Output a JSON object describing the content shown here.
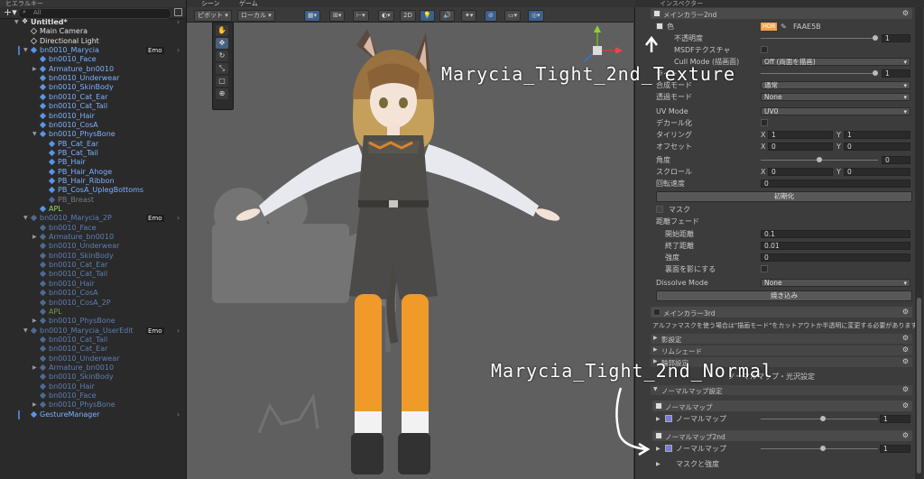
{
  "hierarchy": {
    "tab": "ヒエラルキー",
    "search": "All",
    "rows": [
      {
        "label": "Untitled*",
        "indent": 0,
        "icon": "unity-icon",
        "arrow": "▼",
        "style": "white",
        "emo": "",
        "chev": true
      },
      {
        "label": "Main Camera",
        "indent": 1,
        "icon": "cube-icon",
        "arrow": "",
        "style": "white",
        "emo": "",
        "chev": false
      },
      {
        "label": "Directional Light",
        "indent": 1,
        "icon": "cube-icon",
        "arrow": "",
        "style": "white",
        "emo": "",
        "chev": false
      },
      {
        "label": "bn0010_Marycia",
        "indent": 1,
        "icon": "prefab-icon",
        "arrow": "▼",
        "style": "blue",
        "emo": "Emo",
        "chev": true
      },
      {
        "label": "bn0010_Face",
        "indent": 2,
        "icon": "prefab-icon",
        "arrow": "",
        "style": "blue",
        "emo": "",
        "chev": false
      },
      {
        "label": "Armature_bn0010",
        "indent": 2,
        "icon": "prefab-icon",
        "arrow": "▶",
        "style": "blue",
        "emo": "",
        "chev": false
      },
      {
        "label": "bn0010_Underwear",
        "indent": 2,
        "icon": "prefab-icon",
        "arrow": "",
        "style": "blue",
        "emo": "",
        "chev": false
      },
      {
        "label": "bn0010_SkinBody",
        "indent": 2,
        "icon": "prefab-icon",
        "arrow": "",
        "style": "blue",
        "emo": "",
        "chev": false
      },
      {
        "label": "bn0010_Cat_Ear",
        "indent": 2,
        "icon": "prefab-icon",
        "arrow": "",
        "style": "blue",
        "emo": "",
        "chev": false
      },
      {
        "label": "bn0010_Cat_Tail",
        "indent": 2,
        "icon": "prefab-icon",
        "arrow": "",
        "style": "blue",
        "emo": "",
        "chev": false
      },
      {
        "label": "bn0010_Hair",
        "indent": 2,
        "icon": "prefab-icon",
        "arrow": "",
        "style": "blue",
        "emo": "",
        "chev": false
      },
      {
        "label": "bn0010_CosA",
        "indent": 2,
        "icon": "prefab-icon",
        "arrow": "",
        "style": "blue",
        "emo": "",
        "chev": false
      },
      {
        "label": "bn0010_PhysBone",
        "indent": 2,
        "icon": "prefab-icon",
        "arrow": "▼",
        "style": "blue",
        "emo": "",
        "chev": false
      },
      {
        "label": "PB_Cat_Ear",
        "indent": 3,
        "icon": "prefab-icon",
        "arrow": "",
        "style": "blue",
        "emo": "",
        "chev": false
      },
      {
        "label": "PB_Cat_Tail",
        "indent": 3,
        "icon": "prefab-icon",
        "arrow": "",
        "style": "blue",
        "emo": "",
        "chev": false
      },
      {
        "label": "PB_Hair",
        "indent": 3,
        "icon": "prefab-icon",
        "arrow": "",
        "style": "blue",
        "emo": "",
        "chev": false
      },
      {
        "label": "PB_Hair_Ahoge",
        "indent": 3,
        "icon": "prefab-icon",
        "arrow": "",
        "style": "blue",
        "emo": "",
        "chev": false
      },
      {
        "label": "PB_Hair_Ribbon",
        "indent": 3,
        "icon": "prefab-icon",
        "arrow": "",
        "style": "blue",
        "emo": "",
        "chev": false
      },
      {
        "label": "PB_CosA_UplegBottoms",
        "indent": 3,
        "icon": "prefab-icon",
        "arrow": "",
        "style": "blue",
        "emo": "",
        "chev": false
      },
      {
        "label": "PB_Breast",
        "indent": 3,
        "icon": "prefab-icon",
        "arrow": "",
        "style": "dimw",
        "emo": "",
        "chev": false
      },
      {
        "label": "APL",
        "indent": 2,
        "icon": "prefab-icon",
        "arrow": "",
        "style": "green",
        "emo": "",
        "chev": false
      },
      {
        "label": "bn0010_Marycia_2P",
        "indent": 1,
        "icon": "prefab-icon",
        "arrow": "▼",
        "style": "dim",
        "emo": "Emo",
        "chev": true
      },
      {
        "label": "bn0010_Face",
        "indent": 2,
        "icon": "prefab-icon",
        "arrow": "",
        "style": "dim",
        "emo": "",
        "chev": false
      },
      {
        "label": "Armature_bn0010",
        "indent": 2,
        "icon": "prefab-icon",
        "arrow": "▶",
        "style": "dim",
        "emo": "",
        "chev": false
      },
      {
        "label": "bn0010_Underwear",
        "indent": 2,
        "icon": "prefab-icon",
        "arrow": "",
        "style": "dim",
        "emo": "",
        "chev": false
      },
      {
        "label": "bn0010_SkinBody",
        "indent": 2,
        "icon": "prefab-icon",
        "arrow": "",
        "style": "dim",
        "emo": "",
        "chev": false
      },
      {
        "label": "bn0010_Cat_Ear",
        "indent": 2,
        "icon": "prefab-icon",
        "arrow": "",
        "style": "dim",
        "emo": "",
        "chev": false
      },
      {
        "label": "bn0010_Cat_Tail",
        "indent": 2,
        "icon": "prefab-icon",
        "arrow": "",
        "style": "dim",
        "emo": "",
        "chev": false
      },
      {
        "label": "bn0010_Hair",
        "indent": 2,
        "icon": "prefab-icon",
        "arrow": "",
        "style": "dim",
        "emo": "",
        "chev": false
      },
      {
        "label": "bn0010_CosA",
        "indent": 2,
        "icon": "prefab-icon",
        "arrow": "",
        "style": "dim",
        "emo": "",
        "chev": false
      },
      {
        "label": "bn0010_CosA_2P",
        "indent": 2,
        "icon": "prefab-icon",
        "arrow": "",
        "style": "dim",
        "emo": "",
        "chev": false
      },
      {
        "label": "APL",
        "indent": 2,
        "icon": "prefab-icon",
        "arrow": "",
        "style": "dimgreen",
        "emo": "",
        "chev": false
      },
      {
        "label": "bn0010_PhysBone",
        "indent": 2,
        "icon": "prefab-icon",
        "arrow": "▶",
        "style": "dim",
        "emo": "",
        "chev": false
      },
      {
        "label": "bn0010_Marycia_UserEdit",
        "indent": 1,
        "icon": "prefab-icon",
        "arrow": "▼",
        "style": "dim",
        "emo": "Emo",
        "chev": true
      },
      {
        "label": "bn0010_Cat_Tail",
        "indent": 2,
        "icon": "prefab-icon",
        "arrow": "",
        "style": "dim",
        "emo": "",
        "chev": false
      },
      {
        "label": "bn0010_Cat_Ear",
        "indent": 2,
        "icon": "prefab-icon",
        "arrow": "",
        "style": "dim",
        "emo": "",
        "chev": false
      },
      {
        "label": "bn0010_Underwear",
        "indent": 2,
        "icon": "prefab-icon",
        "arrow": "",
        "style": "dim",
        "emo": "",
        "chev": false
      },
      {
        "label": "Armature_bn0010",
        "indent": 2,
        "icon": "prefab-icon",
        "arrow": "▶",
        "style": "dim",
        "emo": "",
        "chev": false
      },
      {
        "label": "bn0010_SkinBody",
        "indent": 2,
        "icon": "prefab-icon",
        "arrow": "",
        "style": "dim",
        "emo": "",
        "chev": false
      },
      {
        "label": "bn0010_Hair",
        "indent": 2,
        "icon": "prefab-icon",
        "arrow": "",
        "style": "dim",
        "emo": "",
        "chev": false
      },
      {
        "label": "bn0010_Face",
        "indent": 2,
        "icon": "prefab-icon",
        "arrow": "",
        "style": "dim",
        "emo": "",
        "chev": false
      },
      {
        "label": "bn0010_PhysBone",
        "indent": 2,
        "icon": "prefab-icon",
        "arrow": "▶",
        "style": "dim",
        "emo": "",
        "chev": false
      },
      {
        "label": "GestureManager",
        "indent": 1,
        "icon": "prefab-icon",
        "arrow": "",
        "style": "blue",
        "emo": "",
        "chev": true
      }
    ]
  },
  "scene": {
    "tab_scene": "シーン",
    "tab_game": "ゲーム",
    "pivot": "ピボット",
    "local": "ローカル",
    "mode_2d": "2D",
    "annotation_texture": "Marycia_Tight_2nd_Texture",
    "annotation_normal": "Marycia_Tight_2nd_Normal"
  },
  "inspector": {
    "tab": "インスペクター",
    "main2": {
      "header": "メインカラー2nd",
      "color_label": "色",
      "hdr": "HDR",
      "hex": "FAAE5B",
      "opacity_label": "不透明度",
      "opacity_value": "1",
      "msdf_label": "MSDFテクスチャ",
      "cull_label": "Cull Mode (描画面)",
      "cull_value": "Off (両面を描画)",
      "light_label": "ライト",
      "light_value": "1",
      "blend_label": "合成モード",
      "blend_value": "通常",
      "alpha_label": "透過モード",
      "alpha_value": "None",
      "uv_label": "UV Mode",
      "uv_value": "UV0",
      "decal_label": "デカール化",
      "tiling_label": "タイリング",
      "tiling_x": "1",
      "tiling_y": "1",
      "offset_label": "オフセット",
      "offset_x": "0",
      "offset_y": "0",
      "angle_label": "角度",
      "angle_value": "0",
      "scroll_label": "スクロール",
      "scroll_x": "0",
      "scroll_y": "0",
      "rot_label": "回転速度",
      "rot_value": "0",
      "init_btn": "初期化",
      "mask_label": "マスク",
      "fade_label": "距離フェード",
      "fade_start_label": "開始距離",
      "fade_start_value": "0.1",
      "fade_end_label": "終了距離",
      "fade_end_value": "0.01",
      "strength_label": "強度",
      "strength_value": "0",
      "backface_label": "裏面を影にする",
      "dissolve_label": "Dissolve Mode",
      "dissolve_value": "None",
      "bake_btn": "焼き込み"
    },
    "main3_header": "メインカラー3rd",
    "alpha_warning": "アルファマスクを使う場合は\"描画モード\"をカットアウトか半透明に変更する必要があります。",
    "folds": [
      "影設定",
      "リムシェード",
      "輪郭設定"
    ],
    "normal_title": "ノーマルマップ・光沢設定",
    "normal_fold": "ノーマルマップ設定",
    "normal1_header": "ノーマルマップ",
    "normal1_sub": "ノーマルマップ",
    "normal1_value": "1",
    "normal2_header": "ノーマルマップ2nd",
    "normal2_sub": "ノーマルマップ",
    "normal2_value": "1",
    "mask_strength": "マスクと強度"
  },
  "colors": {
    "accent": "#3c5f8c",
    "main2_color": "#FAAE5B"
  }
}
